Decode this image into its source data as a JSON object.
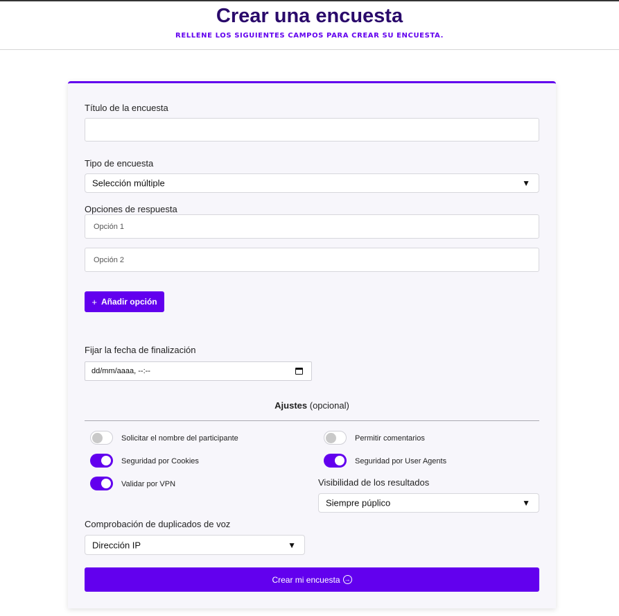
{
  "header": {
    "title": "Crear una encuesta",
    "subtitle": "RELLENE LOS SIGUIENTES CAMPOS PARA CREAR SU ENCUESTA."
  },
  "form": {
    "title_label": "Título de la encuesta",
    "title_value": "",
    "type_label": "Tipo de encuesta",
    "type_selected": "Selección múltiple",
    "options_label": "Opciones de respuesta",
    "options": [
      {
        "placeholder": "Opción 1",
        "value": ""
      },
      {
        "placeholder": "Opción 2",
        "value": ""
      }
    ],
    "add_option_label": "Añadir opción",
    "end_date_label": "Fijar la fecha de finalización",
    "end_date_value": "dd/mm/aaaa, --:--"
  },
  "settings": {
    "title_bold": "Ajustes",
    "title_rest": "(opcional)",
    "toggles": [
      {
        "label": "Solicitar el nombre del participante",
        "on": false
      },
      {
        "label": "Permitir comentarios",
        "on": false
      },
      {
        "label": "Seguridad por Cookies",
        "on": true
      },
      {
        "label": "Seguridad por User Agents",
        "on": true
      },
      {
        "label": "Validar por VPN",
        "on": true
      }
    ],
    "visibility_label": "Visibilidad de los resultados",
    "visibility_selected": "Siempre púplico",
    "duplicates_label": "Comprobación de duplicados de voz",
    "duplicates_selected": "Dirección IP"
  },
  "submit_label": "Crear mi encuesta",
  "icons": {
    "plus": "plus-icon",
    "arrow": "arrow-circle-right-icon",
    "dropdown": "caret-down-icon",
    "calendar": "calendar-icon"
  },
  "colors": {
    "accent": "#6200ee",
    "title": "#2a0a6b",
    "card_bg": "#f7f6fb"
  }
}
